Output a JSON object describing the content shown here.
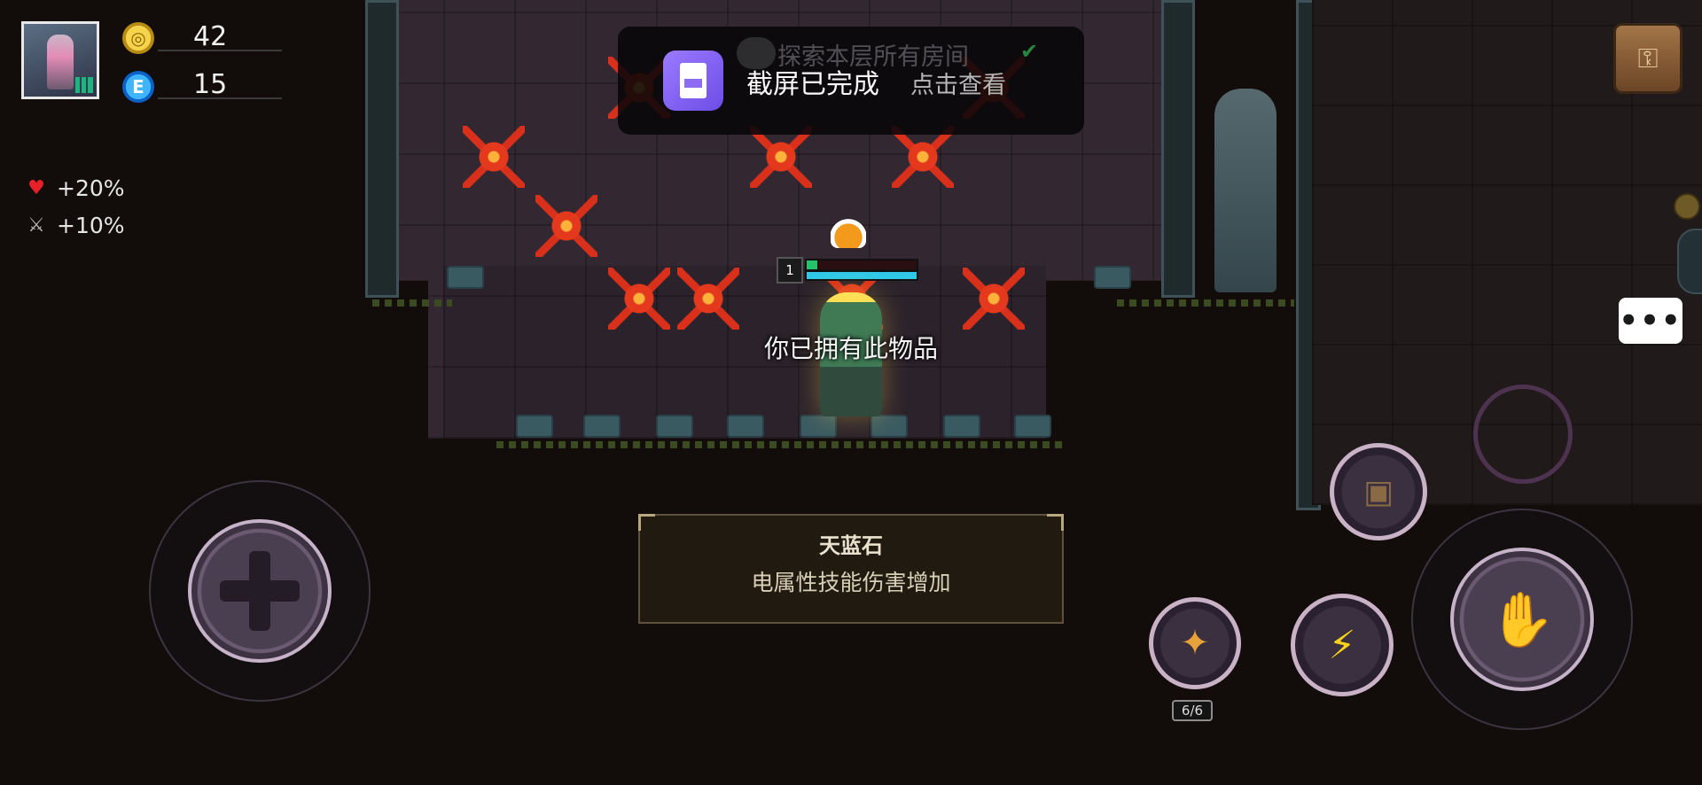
{
  "hud": {
    "gold": "42",
    "energy": "15",
    "gold_icon": "coin-icon",
    "energy_icon": "energy-gem-icon",
    "buffs": [
      {
        "icon": "heart-icon",
        "value": "+20%"
      },
      {
        "icon": "sword-icon",
        "value": "+10%"
      }
    ]
  },
  "notification": {
    "background_text": "探索本层所有房间",
    "title": "截屏已完成",
    "action": "点击查看",
    "icon": "screenshot-icon",
    "accent": "#7c5cf0"
  },
  "player": {
    "level": "1",
    "hp_fraction": 0.1,
    "mp_fraction": 1.0,
    "message": "你已拥有此物品"
  },
  "item": {
    "name": "天蓝石",
    "description": "电属性技能伤害增加"
  },
  "controls": {
    "skill_counter": "6/6",
    "lightning_icon": "lightning-icon",
    "hand_icon": "hand-icon",
    "chat_icon": "chat-bubble-icon",
    "bag_icon": "backpack-icon"
  },
  "colors": {
    "background": "#120d0a",
    "hp": "#24c26a",
    "mp": "#2fc8e8",
    "lava": "#e4391d"
  }
}
